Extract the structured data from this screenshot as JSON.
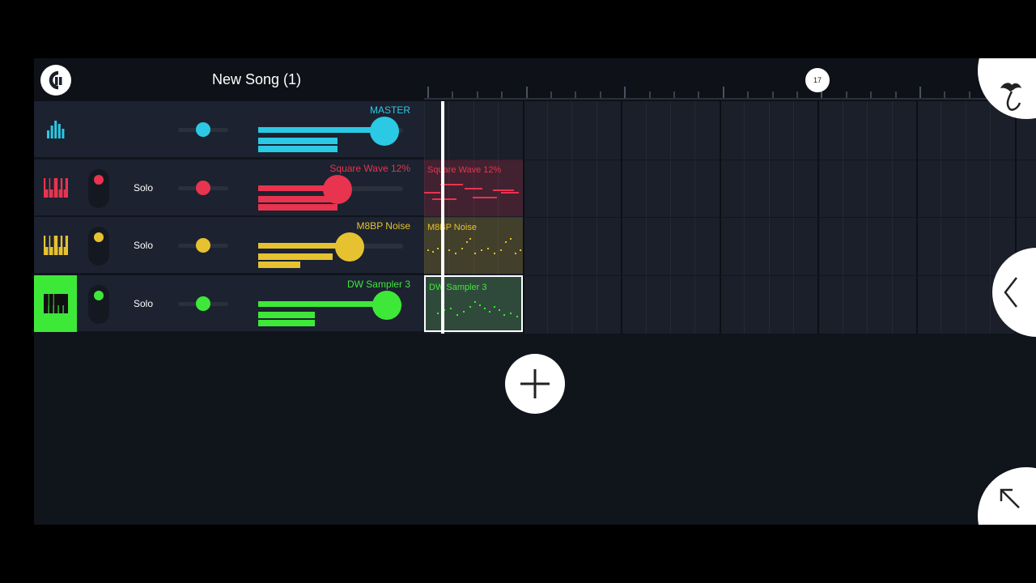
{
  "song": {
    "title": "New Song (1)"
  },
  "timeline": {
    "bar_marker": "17"
  },
  "tracks": [
    {
      "name": "MASTER",
      "color": "#2bc9e4",
      "type": "master",
      "icon": "mixer-bars-icon",
      "solo": "",
      "pan": 0.5,
      "volume": 0.87
    },
    {
      "name": "Square Wave 12%",
      "color": "#e8344f",
      "type": "instrument",
      "icon": "piano-keys-icon",
      "solo": "Solo",
      "pan": 0.5,
      "volume": 0.55
    },
    {
      "name": "M8BP Noise",
      "color": "#e6c230",
      "type": "instrument",
      "icon": "piano-keys-icon",
      "solo": "Solo",
      "pan": 0.5,
      "volume": 0.63
    },
    {
      "name": "DW Sampler 3",
      "color": "#3ee838",
      "type": "instrument",
      "icon": "piano-keys-icon",
      "solo": "Solo",
      "pan": 0.5,
      "volume": 0.89,
      "selected": true
    }
  ],
  "patterns": [
    {
      "label": "Square Wave 12%",
      "color": "#e8344f"
    },
    {
      "label": "M8BP Noise",
      "color": "#e6c230"
    },
    {
      "label": "DW Sampler 3",
      "color": "#3ee838"
    }
  ],
  "icons": {
    "menu": "menu-logo-icon",
    "add": "plus-icon",
    "fl": "fl-fruit-logo-icon",
    "collapse": "chevron-left-icon",
    "expand": "arrow-up-left-icon"
  }
}
